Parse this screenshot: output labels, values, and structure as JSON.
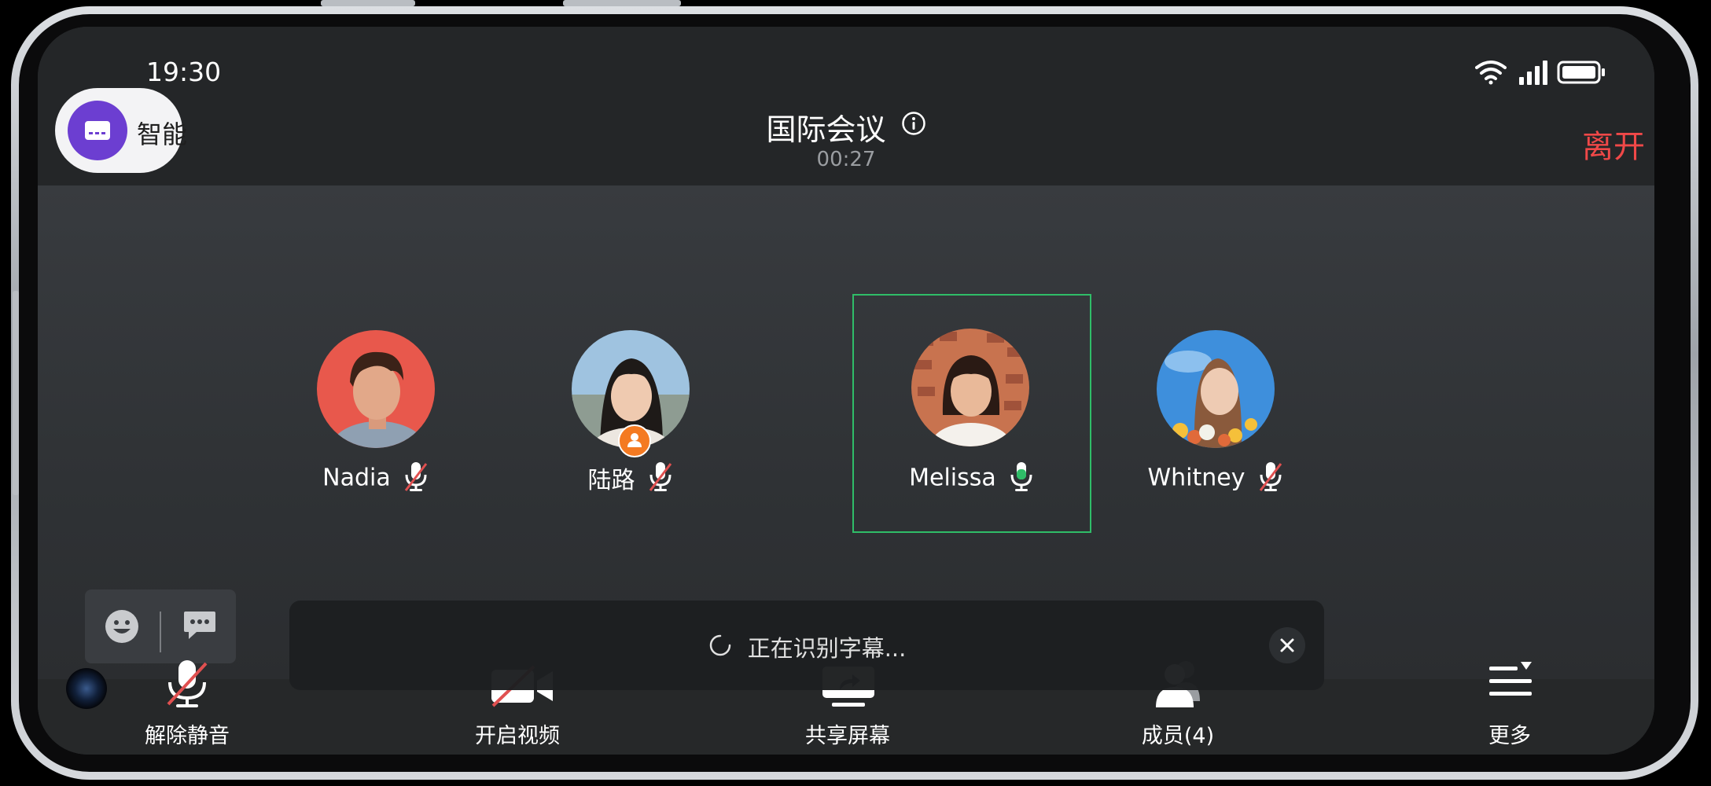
{
  "status_bar": {
    "time": "19:30"
  },
  "smart_assist": {
    "label": "智能"
  },
  "meeting": {
    "title": "国际会议",
    "timer": "00:27",
    "leave_label": "离开"
  },
  "participants": [
    {
      "name": "Nadia",
      "mic": "muted",
      "host": false,
      "active": false
    },
    {
      "name": "陆路",
      "mic": "muted",
      "host": true,
      "active": false
    },
    {
      "name": "Melissa",
      "mic": "speaking",
      "host": false,
      "active": true
    },
    {
      "name": "Whitney",
      "mic": "muted",
      "host": false,
      "active": false
    }
  ],
  "caption": {
    "status_text": "正在识别字幕..."
  },
  "toolbar": {
    "unmute_label": "解除静音",
    "video_label": "开启视频",
    "share_label": "共享屏幕",
    "members_label": "成员(4)",
    "more_label": "更多"
  },
  "colors": {
    "active_border": "#2fbd68",
    "leave": "#f04848",
    "speaking_mic": "#2fbd68",
    "muted_slash": "#e05050",
    "smart_accent": "#6c3ed1",
    "host_badge": "#f47a22"
  },
  "icons": [
    "wifi-icon",
    "signal-icon",
    "battery-icon",
    "info-icon",
    "subtitle-icon",
    "emoji-icon",
    "chat-icon",
    "spinner-icon",
    "close-icon",
    "mic-muted-icon",
    "video-off-icon",
    "share-screen-icon",
    "members-icon",
    "more-icon"
  ]
}
